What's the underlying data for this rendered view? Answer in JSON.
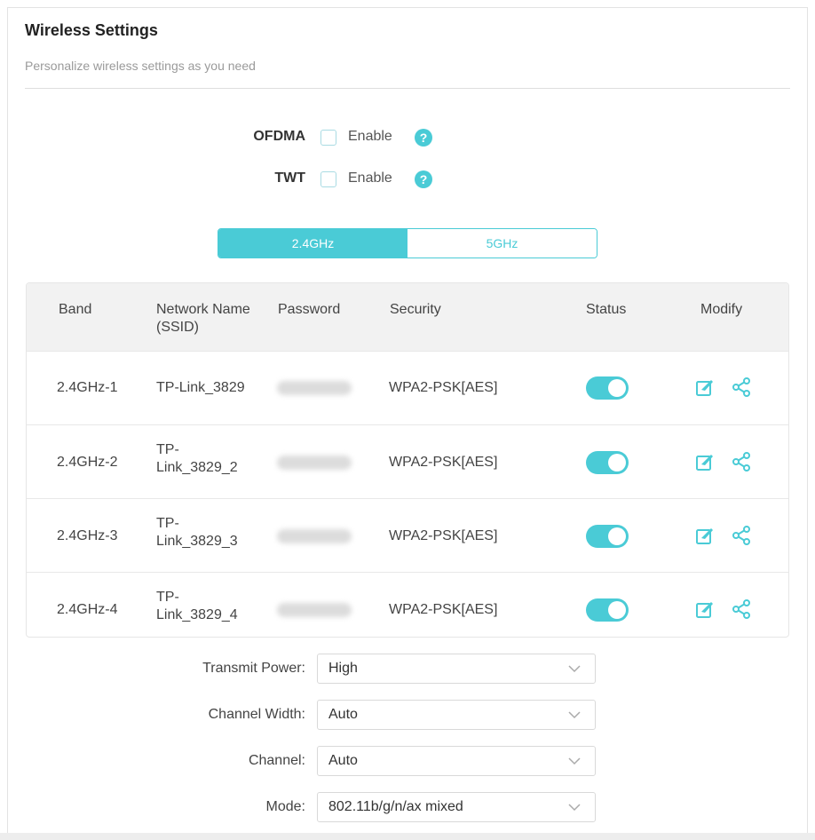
{
  "header": {
    "title": "Wireless Settings",
    "subtitle": "Personalize wireless settings as you need"
  },
  "options": [
    {
      "label": "OFDMA",
      "checkbox_label": "Enable",
      "checked": false
    },
    {
      "label": "TWT",
      "checkbox_label": "Enable",
      "checked": false
    }
  ],
  "band_tabs": {
    "active": "2.4GHz",
    "inactive": "5GHz"
  },
  "table": {
    "headers": {
      "band": "Band",
      "ssid_line1": "Network Name",
      "ssid_line2": "(SSID)",
      "password": "Password",
      "security": "Security",
      "status": "Status",
      "modify": "Modify"
    },
    "rows": [
      {
        "band": "2.4GHz-1",
        "ssid_line1": "TP-Link_3829",
        "ssid_line2": "",
        "security": "WPA2-PSK[AES]",
        "status_on": true
      },
      {
        "band": "2.4GHz-2",
        "ssid_line1": "TP-",
        "ssid_line2": "Link_3829_2",
        "security": "WPA2-PSK[AES]",
        "status_on": true
      },
      {
        "band": "2.4GHz-3",
        "ssid_line1": "TP-",
        "ssid_line2": "Link_3829_3",
        "security": "WPA2-PSK[AES]",
        "status_on": true
      },
      {
        "band": "2.4GHz-4",
        "ssid_line1": "TP-",
        "ssid_line2": "Link_3829_4",
        "security": "WPA2-PSK[AES]",
        "status_on": true
      }
    ]
  },
  "fields": {
    "transmit_power": {
      "label": "Transmit Power:",
      "value": "High"
    },
    "channel_width": {
      "label": "Channel Width:",
      "value": "Auto"
    },
    "channel": {
      "label": "Channel:",
      "value": "Auto"
    },
    "mode": {
      "label": "Mode:",
      "value": "802.11b/g/n/ax mixed"
    }
  },
  "icons": {
    "help": "help-icon",
    "edit": "edit-icon",
    "share": "share-icon",
    "chevron": "chevron-down-icon"
  },
  "colors": {
    "accent": "#4acbd6"
  }
}
